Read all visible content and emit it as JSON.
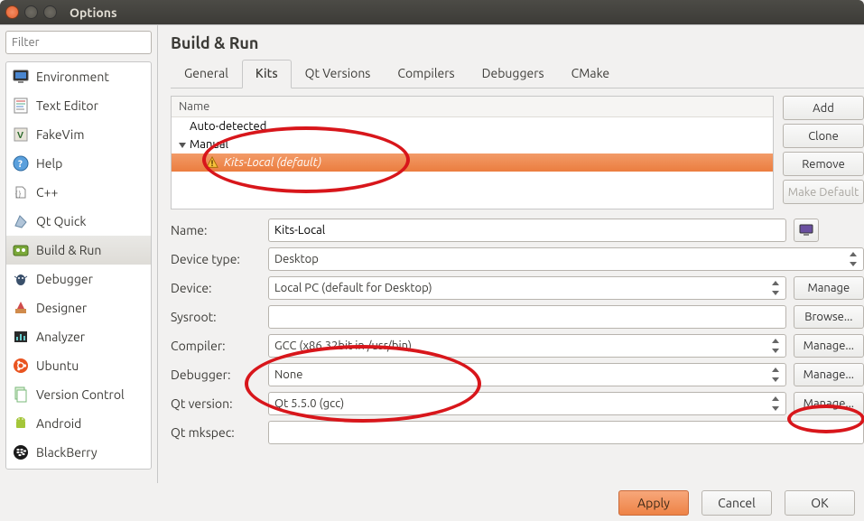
{
  "window": {
    "title": "Options"
  },
  "sidebar": {
    "filter_placeholder": "Filter",
    "items": [
      {
        "label": "Environment",
        "icon": "monitor"
      },
      {
        "label": "Text Editor",
        "icon": "texteditor"
      },
      {
        "label": "FakeVim",
        "icon": "fakevim"
      },
      {
        "label": "Help",
        "icon": "help"
      },
      {
        "label": "C++",
        "icon": "cpp"
      },
      {
        "label": "Qt Quick",
        "icon": "qtquick"
      },
      {
        "label": "Build & Run",
        "icon": "buildrun"
      },
      {
        "label": "Debugger",
        "icon": "debugger"
      },
      {
        "label": "Designer",
        "icon": "designer"
      },
      {
        "label": "Analyzer",
        "icon": "analyzer"
      },
      {
        "label": "Ubuntu",
        "icon": "ubuntu"
      },
      {
        "label": "Version Control",
        "icon": "vcs"
      },
      {
        "label": "Android",
        "icon": "android"
      },
      {
        "label": "BlackBerry",
        "icon": "blackberry"
      }
    ],
    "selected_index": 6
  },
  "main": {
    "heading": "Build & Run",
    "tabs": [
      "General",
      "Kits",
      "Qt Versions",
      "Compilers",
      "Debuggers",
      "CMake"
    ],
    "active_tab_index": 1,
    "tree_header": "Name",
    "tree": {
      "autodetect_label": "Auto-detected",
      "manual_label": "Manual",
      "selected_item": "Kits-Local (default)"
    },
    "side_buttons": {
      "add": "Add",
      "clone": "Clone",
      "remove": "Remove",
      "make_default": "Make Default"
    },
    "form": {
      "name_label": "Name:",
      "name_value": "Kits-Local",
      "devtype_label": "Device type:",
      "devtype_value": "Desktop",
      "device_label": "Device:",
      "device_value": "Local PC (default for Desktop)",
      "device_btn": "Manage",
      "sysroot_label": "Sysroot:",
      "sysroot_value": "",
      "sysroot_btn": "Browse...",
      "compiler_label": "Compiler:",
      "compiler_value": "GCC (x86 32bit in /usr/bin)",
      "compiler_btn": "Manage...",
      "debugger_label": "Debugger:",
      "debugger_value": "None",
      "debugger_btn": "Manage...",
      "qtver_label": "Qt version:",
      "qtver_value": "Qt 5.5.0 (gcc)",
      "qtver_btn": "Manage...",
      "mkspec_label": "Qt mkspec:",
      "mkspec_value": ""
    }
  },
  "footer": {
    "apply": "Apply",
    "cancel": "Cancel",
    "ok": "OK"
  }
}
